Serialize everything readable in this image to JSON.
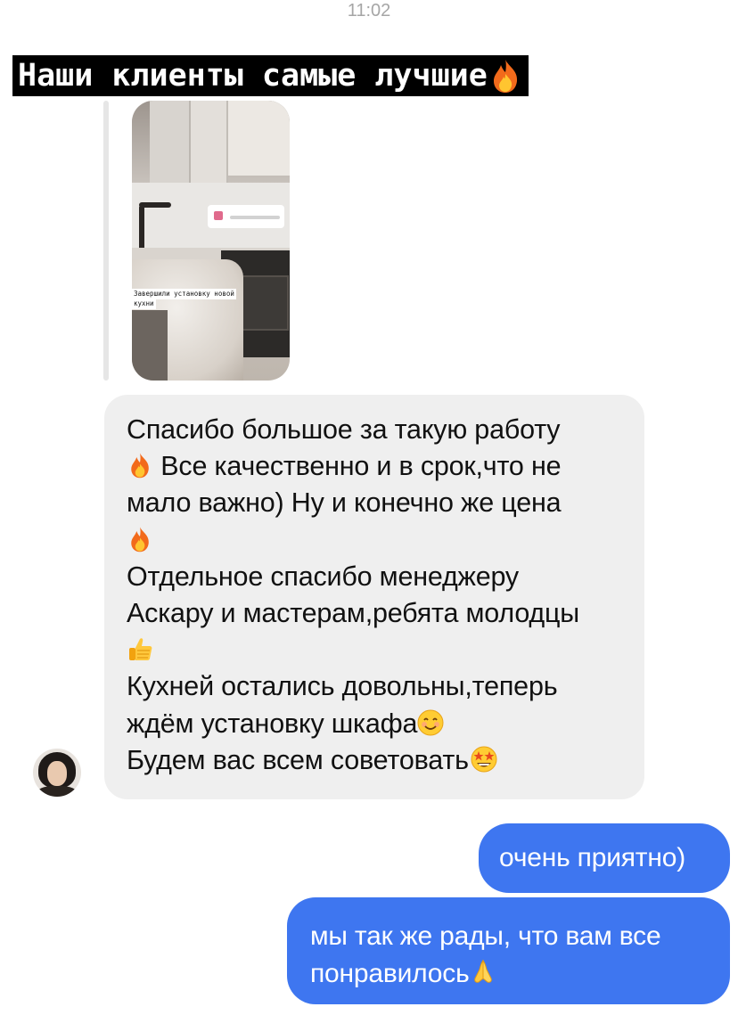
{
  "status_bar": {
    "time": "11:02"
  },
  "banner": {
    "text": "Наши клиенты самые лучшие",
    "icon": "fire-emoji"
  },
  "story_reply": {
    "caption_line1": "Завершили установку новой",
    "caption_line2": "кухни"
  },
  "incoming_message": {
    "lines": [
      "Спасибо большое за такую работу",
      " Все качественно и в срок,что не",
      "мало важно) Ну и конечно же цена",
      "",
      "Отдельное спасибо менеджеру",
      "Аскару и мастерам,ребята молодцы",
      "",
      "Кухней остались довольны,теперь",
      "ждём установку шкафа",
      "Будем вас всем советовать"
    ]
  },
  "outgoing_messages": [
    {
      "text": "очень приятно)"
    },
    {
      "line1": "мы так же рады, что вам все",
      "line2": "понравилось"
    }
  ],
  "colors": {
    "outgoing_bubble": "#3e76f0",
    "incoming_bubble": "#efefef",
    "banner_bg": "#000000"
  }
}
